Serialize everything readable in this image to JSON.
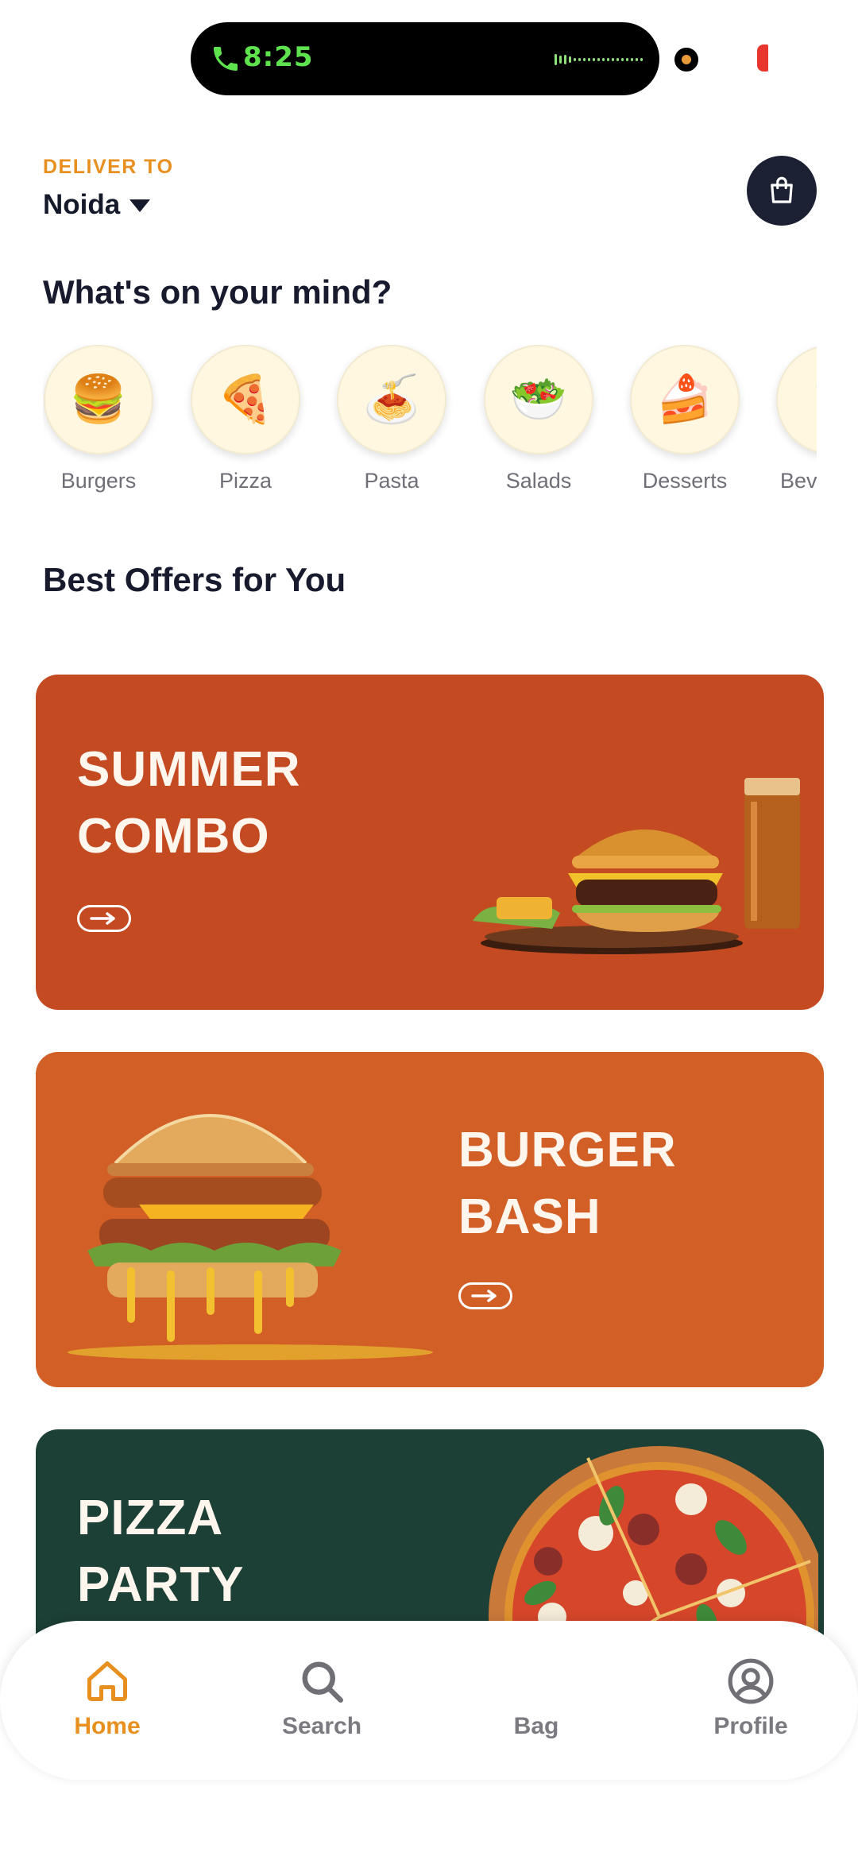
{
  "status_bar": {
    "time": "8:25"
  },
  "header": {
    "deliver_label": "DELIVER TO",
    "location": "Noida"
  },
  "categories_title": "What's on your mind?",
  "categories": [
    {
      "label": "Burgers",
      "emoji": "🍔"
    },
    {
      "label": "Pizza",
      "emoji": "🍕"
    },
    {
      "label": "Pasta",
      "emoji": "🍝"
    },
    {
      "label": "Salads",
      "emoji": "🥗"
    },
    {
      "label": "Desserts",
      "emoji": "🍰"
    },
    {
      "label": "Beverages",
      "emoji": "🥤"
    }
  ],
  "offers_title": "Best Offers for You",
  "offers": [
    {
      "line1": "SUMMER",
      "line2": "COMBO",
      "color": "#c44a22"
    },
    {
      "line1": "BURGER",
      "line2": "BASH",
      "color": "#d25f26"
    },
    {
      "line1": "PIZZA",
      "line2": "PARTY",
      "color": "#1c3f36"
    }
  ],
  "nav": {
    "items": [
      {
        "label": "Home",
        "icon": "home-icon"
      },
      {
        "label": "Search",
        "icon": "search-icon"
      },
      {
        "label": "Bag",
        "icon": "bag-icon"
      },
      {
        "label": "Profile",
        "icon": "profile-icon"
      }
    ],
    "active_color": "#e8901f",
    "inactive_color": "#7a7a80"
  }
}
